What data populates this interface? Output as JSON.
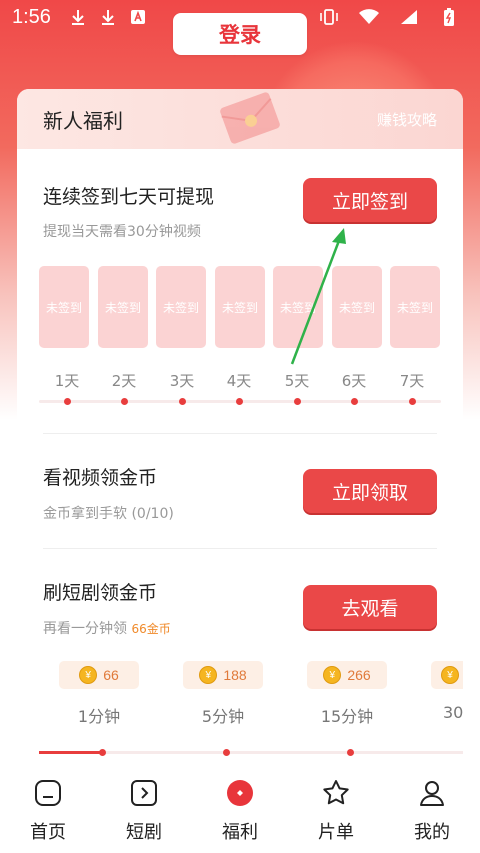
{
  "status_bar": {
    "time": "1:56"
  },
  "header": {
    "login_label": "登录"
  },
  "card": {
    "title": "新人福利",
    "guide_link": "赚钱攻略",
    "checkin": {
      "title": "连续签到七天可提现",
      "subtitle": "提现当天需看30分钟视频",
      "button": "立即签到",
      "days": [
        {
          "status": "未签到",
          "label": "1天"
        },
        {
          "status": "未签到",
          "label": "2天"
        },
        {
          "status": "未签到",
          "label": "3天"
        },
        {
          "status": "未签到",
          "label": "4天"
        },
        {
          "status": "未签到",
          "label": "5天"
        },
        {
          "status": "未签到",
          "label": "6天"
        },
        {
          "status": "未签到",
          "label": "7天"
        }
      ]
    },
    "video": {
      "title": "看视频领金币",
      "subtitle": "金币拿到手软 (0/10)",
      "button": "立即领取"
    },
    "drama": {
      "title": "刷短剧领金币",
      "subtitle_prefix": "再看一分钟领 ",
      "subtitle_highlight": "66金币",
      "button": "去观看",
      "rewards": [
        {
          "coins": "66",
          "label": "1分钟"
        },
        {
          "coins": "188",
          "label": "5分钟"
        },
        {
          "coins": "266",
          "label": "15分钟"
        },
        {
          "coins": "",
          "label": "30"
        }
      ]
    }
  },
  "bottom_nav": [
    {
      "label": "首页",
      "icon": "home-icon"
    },
    {
      "label": "短剧",
      "icon": "play-icon"
    },
    {
      "label": "福利",
      "icon": "gift-icon"
    },
    {
      "label": "片单",
      "icon": "star-icon"
    },
    {
      "label": "我的",
      "icon": "user-icon"
    }
  ],
  "colors": {
    "brand": "#ea4848",
    "coin": "#f5b520",
    "arrow": "#2fb24a"
  }
}
